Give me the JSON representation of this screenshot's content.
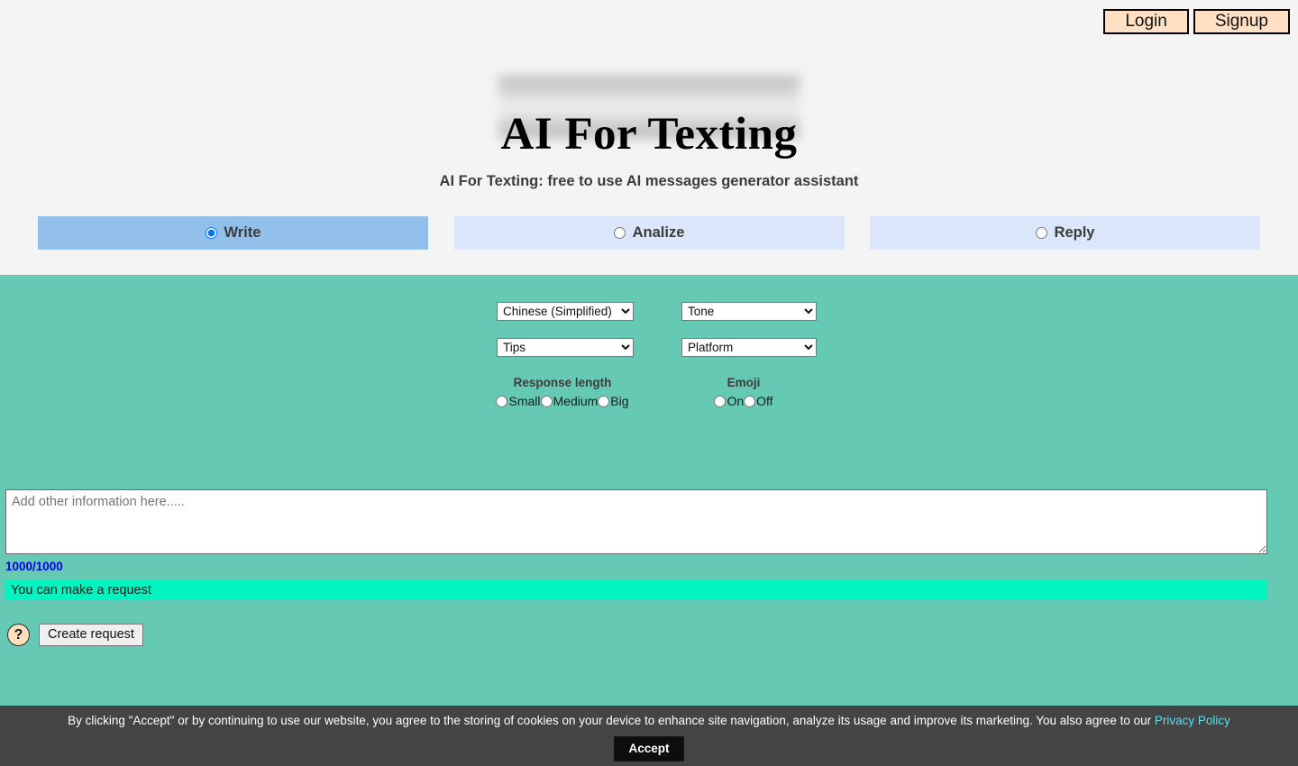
{
  "auth": {
    "login_label": "Login",
    "signup_label": "Signup"
  },
  "header": {
    "title": "AI For Texting",
    "subtitle": "AI For Texting: free to use AI messages generator assistant"
  },
  "modes": [
    {
      "label": "Write",
      "selected": true
    },
    {
      "label": "Analize",
      "selected": false
    },
    {
      "label": "Reply",
      "selected": false
    }
  ],
  "controls": {
    "language": {
      "value": "Chinese (Simplified)"
    },
    "tone": {
      "value": "Tone"
    },
    "tips": {
      "value": "Tips"
    },
    "platform": {
      "value": "Platform"
    }
  },
  "response_length": {
    "title": "Response length",
    "options": [
      "Small",
      "Medium",
      "Big"
    ]
  },
  "emoji": {
    "title": "Emoji",
    "options": [
      "On",
      "Off"
    ]
  },
  "request": {
    "placeholder": "Add other information here.....",
    "value": "",
    "counter": "1000/1000",
    "status": "You can make a request",
    "help_icon": "question-mark-icon",
    "create_label": "Create request"
  },
  "cookie": {
    "text": "By clicking \"Accept\" or by continuing to use our website, you agree to the storing of cookies on your device to enhance site navigation, analyze its usage and improve its marketing. You also agree to our ",
    "link_label": "Privacy Policy",
    "accept_label": "Accept"
  },
  "colors": {
    "page_bg": "#f4f4f5",
    "panel_bg": "#66c9b3",
    "tab_active": "#93c0ea",
    "tab_inactive": "#dce6fb",
    "auth_btn": "#ffe0c2",
    "status_bar": "#00f5c0",
    "counter_text": "#0000ee",
    "banner_bg": "#444444",
    "banner_link": "#4fe3f5"
  }
}
